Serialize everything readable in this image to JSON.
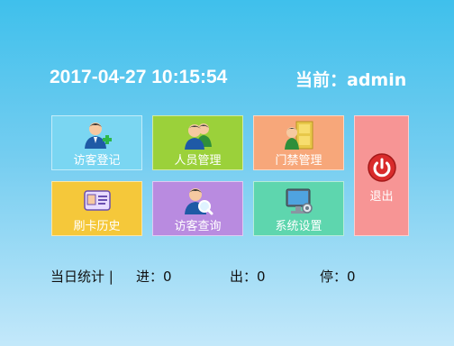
{
  "header": {
    "datetime": "2017-04-27 10:15:54",
    "current_user": "当前：admin"
  },
  "tiles": {
    "visitor_register": {
      "label": "访客登记",
      "icon": "person-add-icon",
      "color": "#7ad6f2"
    },
    "staff_management": {
      "label": "人员管理",
      "icon": "people-icon",
      "color": "#9bd13a"
    },
    "access_control": {
      "label": "门禁管理",
      "icon": "door-icon",
      "color": "#f7a77a"
    },
    "exit": {
      "label": "退出",
      "icon": "power-icon",
      "color": "#f79595"
    },
    "card_history": {
      "label": "刷卡历史",
      "icon": "id-card-icon",
      "color": "#f5c83a"
    },
    "visitor_query": {
      "label": "访客查询",
      "icon": "person-search-icon",
      "color": "#b98be0"
    },
    "system_settings": {
      "label": "系统设置",
      "icon": "settings-computer-icon",
      "color": "#5ed6ae"
    }
  },
  "stats": {
    "label": "当日统计 |",
    "in": "进：0",
    "out": "出：0",
    "stop": "停：0"
  }
}
